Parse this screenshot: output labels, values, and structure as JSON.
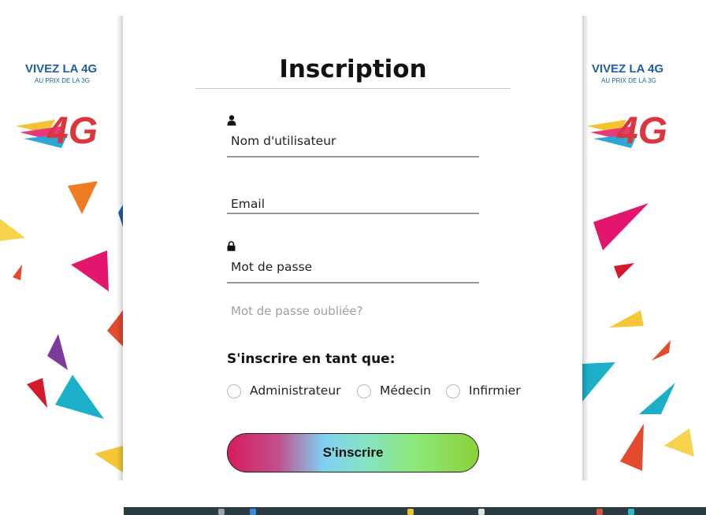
{
  "banner": {
    "headline": "VIVEZ LA 4G",
    "subline": "AU PRIX DE LA 3G",
    "logo_text": "4G"
  },
  "form": {
    "title": "Inscription",
    "username_label": "Nom d'utilisateur",
    "email_label": "Email",
    "password_label": "Mot de passe",
    "forgot_password": "Mot de passe oubliée?",
    "role_heading": "S'inscrire en tant que:",
    "roles": [
      {
        "label": "Administrateur",
        "selected": false
      },
      {
        "label": "Médecin",
        "selected": false
      },
      {
        "label": "Infirmier",
        "selected": false
      }
    ],
    "submit_label": "S'inscrire"
  },
  "icons": {
    "username": "user-icon",
    "password": "lock-icon"
  },
  "colors": {
    "button_gradient": [
      "#d81b5c",
      "#7fcff2",
      "#8ee877",
      "#8ad239"
    ],
    "underline": "#9a9a9a",
    "forgot_text": "#a0a0a0",
    "taskbar": "#2c3a44"
  }
}
